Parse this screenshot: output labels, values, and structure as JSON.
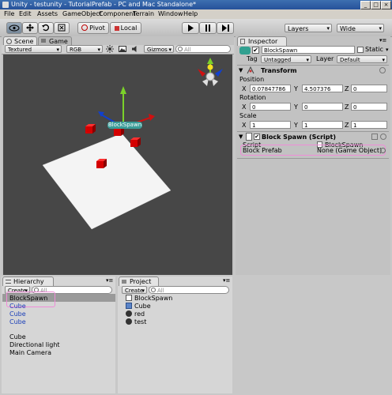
{
  "window": {
    "title": "Unity - testunity - TutorialPrefab - PC and Mac Standalone*",
    "buttons": [
      "_",
      "□",
      "×"
    ]
  },
  "menubar": [
    "File",
    "Edit",
    "Assets",
    "GameObject",
    "Component",
    "Terrain",
    "Window",
    "Help"
  ],
  "toolbar": {
    "pivot_label": "Pivot",
    "local_label": "Local",
    "layers_label": "Layers",
    "layout_label": "Wide"
  },
  "scene": {
    "tab_scene": "Scene",
    "tab_game": "Game",
    "render_mode": "Textured",
    "color_mode": "RGB",
    "gizmos_label": "Gizmos",
    "search_placeholder": "All",
    "object_label": "BlockSpawn"
  },
  "inspector": {
    "tab": "Inspector",
    "object_name": "BlockSpawn",
    "static_label": "Static",
    "tag_label": "Tag",
    "tag_value": "Untagged",
    "layer_label": "Layer",
    "layer_value": "Default",
    "transform": {
      "title": "Transform",
      "position_label": "Position",
      "rotation_label": "Rotation",
      "scale_label": "Scale",
      "position": {
        "x": "0.07847786",
        "y": "4.507376",
        "z": "0"
      },
      "rotation": {
        "x": "0",
        "y": "0",
        "z": "0"
      },
      "scale": {
        "x": "1",
        "y": "1",
        "z": "1"
      },
      "axis_x": "X",
      "axis_y": "Y",
      "axis_z": "Z"
    },
    "script_component": {
      "title": "Block Spawn (Script)",
      "script_label": "Script",
      "script_value": "BlockSpawn",
      "prefab_label": "Block Prefab",
      "prefab_value": "None (Game Object)"
    }
  },
  "hierarchy": {
    "tab": "Hierarchy",
    "create_label": "Create",
    "search_placeholder": "All",
    "items": [
      "BlockSpawn",
      "Cube",
      "Cube",
      "Cube",
      "Cube",
      "Directional light",
      "Main Camera"
    ]
  },
  "project": {
    "tab": "Project",
    "create_label": "Create",
    "search_placeholder": "All",
    "items": [
      "BlockSpawn",
      "Cube",
      "red",
      "test"
    ]
  },
  "colors": {
    "viewport_bg": "#474747",
    "highlight": "#f08cd8",
    "selection": "#9a9a9a",
    "prefab_blue": "#1a3fb8"
  }
}
